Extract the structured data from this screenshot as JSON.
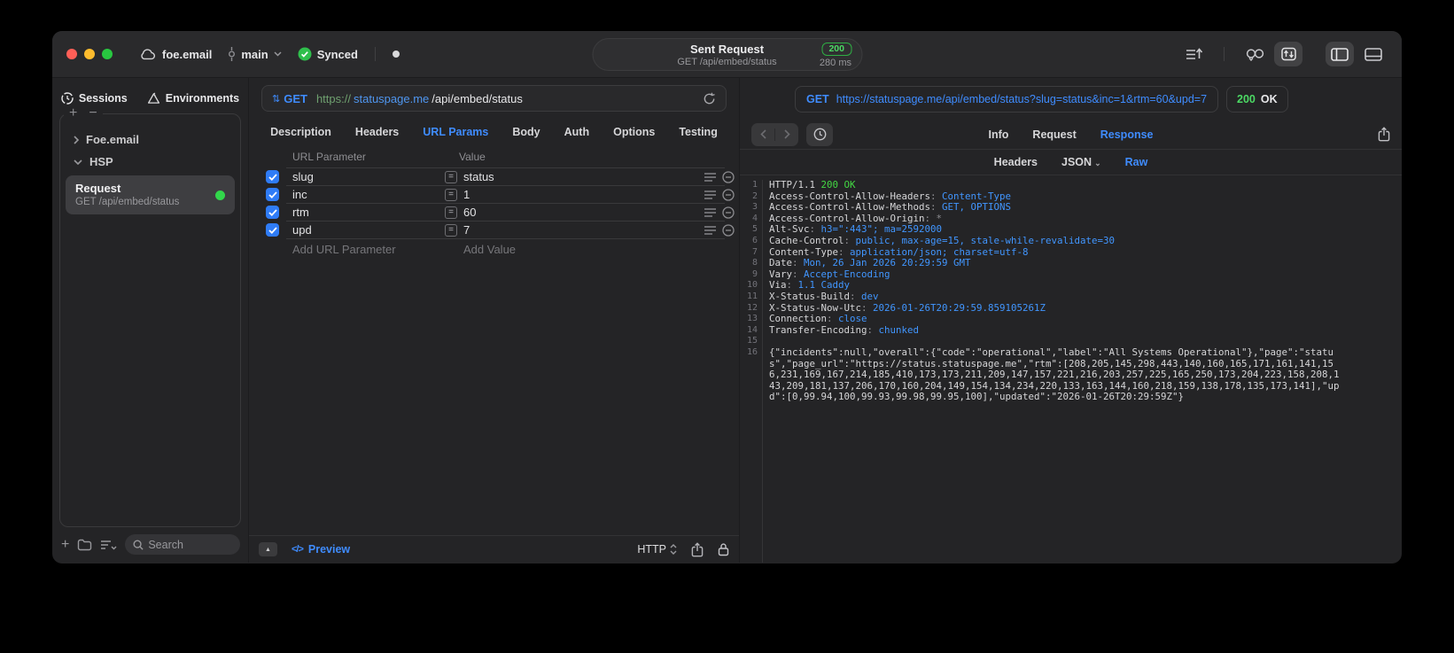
{
  "titlebar": {
    "project": "foe.email",
    "branch": "main",
    "sync_label": "Synced",
    "request_title": "Sent Request",
    "request_subtitle": "GET /api/embed/status",
    "status_code": "200",
    "duration": "280 ms"
  },
  "sidebar": {
    "tabs": [
      {
        "label": "Sessions",
        "active": true
      },
      {
        "label": "Environments",
        "active": false
      }
    ],
    "groups": [
      {
        "label": "Foe.email",
        "expanded": false
      },
      {
        "label": "HSP",
        "expanded": true
      }
    ],
    "request": {
      "title": "Request",
      "subtitle": "GET /api/embed/status"
    },
    "search_placeholder": "Search"
  },
  "request_editor": {
    "method": "GET",
    "url": {
      "scheme": "https://",
      "host": "statuspage.me",
      "path": "/api/embed/status"
    },
    "tabs": [
      "Description",
      "Headers",
      "URL Params",
      "Body",
      "Auth",
      "Options",
      "Testing"
    ],
    "active_tab": "URL Params",
    "params_table": {
      "columns": [
        "URL Parameter",
        "Value"
      ],
      "rows": [
        {
          "checked": true,
          "name": "slug",
          "value": "status"
        },
        {
          "checked": true,
          "name": "inc",
          "value": "1"
        },
        {
          "checked": true,
          "name": "rtm",
          "value": "60"
        },
        {
          "checked": true,
          "name": "upd",
          "value": "7"
        }
      ],
      "add_param_placeholder": "Add URL Parameter",
      "add_value_placeholder": "Add Value"
    },
    "footer": {
      "preview_icon_text": "</>",
      "preview_label": "Preview",
      "scheme_label": "HTTP"
    }
  },
  "response_viewer": {
    "method": "GET",
    "url": "https://statuspage.me/api/embed/status?slug=status&inc=1&rtm=60&upd=7",
    "status_code": "200",
    "status_text": "OK",
    "tabs": [
      "Info",
      "Request",
      "Response"
    ],
    "active_tab": "Response",
    "subtabs": [
      "Headers",
      "JSON",
      "Raw"
    ],
    "active_subtab": "Raw",
    "code": {
      "status_line": {
        "protocol": "HTTP/1.1",
        "status": "200 OK"
      },
      "headers": [
        {
          "name": "Access-Control-Allow-Headers",
          "value": "Content-Type"
        },
        {
          "name": "Access-Control-Allow-Methods",
          "value": "GET, OPTIONS"
        },
        {
          "name": "Access-Control-Allow-Origin",
          "value": "*",
          "muted": true
        },
        {
          "name": "Alt-Svc",
          "value": "h3=\":443\"; ma=2592000"
        },
        {
          "name": "Cache-Control",
          "value": "public, max-age=15, stale-while-revalidate=30"
        },
        {
          "name": "Content-Type",
          "value": "application/json; charset=utf-8"
        },
        {
          "name": "Date",
          "value": "Mon, 26 Jan 2026 20:29:59 GMT"
        },
        {
          "name": "Vary",
          "value": "Accept-Encoding"
        },
        {
          "name": "Via",
          "value": "1.1 Caddy"
        },
        {
          "name": "X-Status-Build",
          "value": "dev"
        },
        {
          "name": "X-Status-Now-Utc",
          "value": "2026-01-26T20:29:59.859105261Z"
        },
        {
          "name": "Connection",
          "value": "close"
        },
        {
          "name": "Transfer-Encoding",
          "value": "chunked"
        }
      ],
      "body": "{\"incidents\":null,\"overall\":{\"code\":\"operational\",\"label\":\"All Systems Operational\"},\"page\":\"status\",\"page_url\":\"https://status.statuspage.me\",\"rtm\":[208,205,145,298,443,140,160,165,171,161,141,156,231,169,167,214,185,410,173,173,211,209,147,157,221,216,203,257,225,165,250,173,204,223,158,208,143,209,181,137,206,170,160,204,149,154,134,234,220,133,163,144,160,218,159,138,178,135,173,141],\"upd\":[0,99.94,100,99.93,99.98,99.95,100],\"updated\":\"2026-01-26T20:29:59Z\"}"
    }
  }
}
